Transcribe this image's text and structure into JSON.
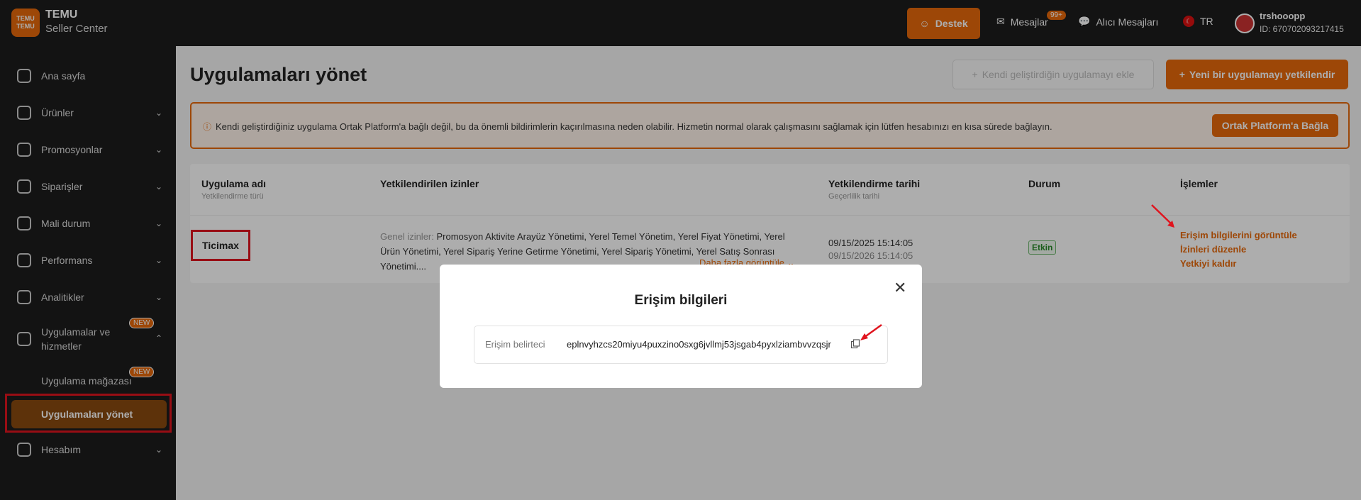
{
  "header": {
    "logo_text": "TEMU",
    "brand_title": "TEMU",
    "brand_subtitle": "Seller Center",
    "support_label": "Destek",
    "messages_label": "Mesajlar",
    "messages_badge": "99+",
    "buyer_messages_label": "Alıcı Mesajları",
    "language": "TR",
    "username": "trshooopp",
    "user_id": "ID: 670702093217415"
  },
  "sidebar": {
    "items": [
      {
        "label": "Ana sayfa"
      },
      {
        "label": "Ürünler"
      },
      {
        "label": "Promosyonlar"
      },
      {
        "label": "Siparişler"
      },
      {
        "label": "Mali durum"
      },
      {
        "label": "Performans"
      },
      {
        "label": "Analitikler"
      },
      {
        "label": "Uygulamalar ve hizmetler",
        "badge": "NEW"
      },
      {
        "label": "Hesabım"
      }
    ],
    "sub_items": [
      {
        "label": "Uygulama mağazası",
        "badge": "NEW"
      },
      {
        "label": "Uygulamaları yönet"
      }
    ]
  },
  "main": {
    "title": "Uygulamaları yönet",
    "add_own_app_label": "Kendi geliştirdiğin uygulamayı ekle",
    "authorize_new_label": "Yeni bir uygulamayı yetkilendir",
    "warning_text": "Kendi geliştirdiğiniz uygulama Ortak Platform'a bağlı değil, bu da önemli bildirimlerin kaçırılmasına neden olabilir. Hizmetin normal olarak çalışmasını sağlamak için lütfen hesabınızı en kısa sürede bağlayın.",
    "connect_label": "Ortak Platform'a Bağla",
    "table": {
      "columns": [
        {
          "label": "Uygulama adı",
          "sub": "Yetkilendirme türü"
        },
        {
          "label": "Yetkilendirilen izinler",
          "sub": ""
        },
        {
          "label": "Yetkilendirme tarihi",
          "sub": "Geçerlilik tarihi"
        },
        {
          "label": "Durum",
          "sub": ""
        },
        {
          "label": "İşlemler",
          "sub": ""
        }
      ],
      "row": {
        "app_name": "Ticimax",
        "perm_label": "Genel izinler:",
        "permissions": "Promosyon Aktivite Arayüz Yönetimi, Yerel Temel Yönetim, Yerel Fiyat Yönetimi, Yerel Ürün Yönetimi, Yerel Sipariş Yerine Getirme Yönetimi, Yerel Sipariş Yönetimi, Yerel Satış Sonrası Yönetimi....",
        "more_label": "Daha fazla görüntüle",
        "auth_date": "09/15/2025 15:14:05",
        "valid_date": "09/15/2026 15:14:05",
        "status": "Etkin",
        "ops": [
          "Erişim bilgilerini görüntüle",
          "İzinleri düzenle",
          "Yetkiyi kaldır"
        ]
      }
    }
  },
  "modal": {
    "title": "Erişim bilgileri",
    "field_label": "Erişim belirteci",
    "field_value": "eplnvyhzcs20miyu4puxzino0sxg6jvllmj53jsgab4pyxlziambvvzqsjr"
  },
  "colors": {
    "accent": "#e8690b",
    "highlight": "#e0141e",
    "dark": "#1c1c1c"
  }
}
